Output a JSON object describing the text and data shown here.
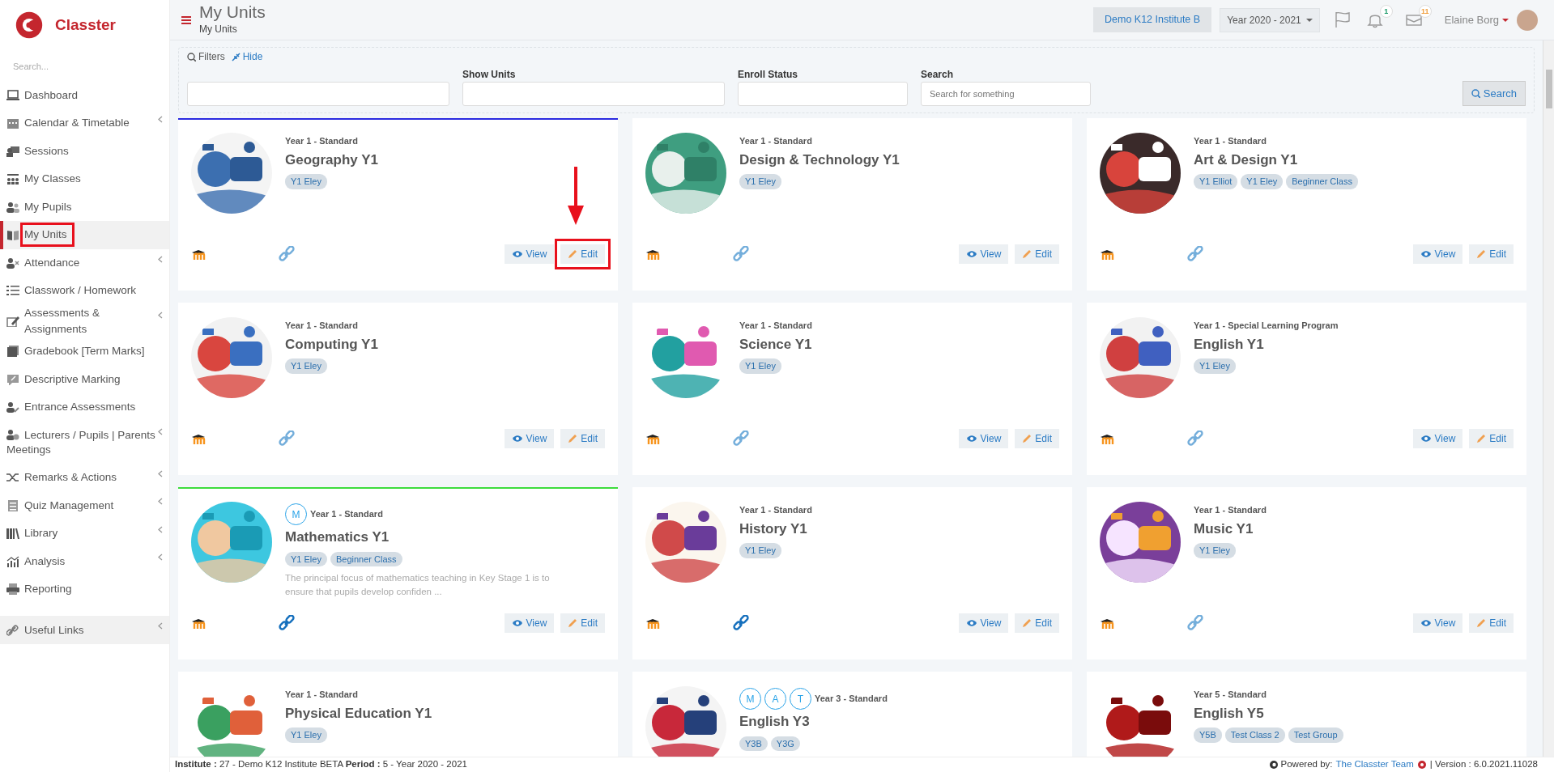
{
  "brand": {
    "name": "Classter"
  },
  "sidebar": {
    "search_placeholder": "Search...",
    "items": [
      {
        "label": "Dashboard",
        "selected": false,
        "has_submenu": false
      },
      {
        "label": "Calendar & Timetable",
        "selected": false,
        "has_submenu": true
      },
      {
        "label": "Sessions",
        "selected": false,
        "has_submenu": false
      },
      {
        "label": "My Classes",
        "selected": false,
        "has_submenu": false
      },
      {
        "label": "My Pupils",
        "selected": false,
        "has_submenu": false
      },
      {
        "label": "My Units",
        "selected": true,
        "has_submenu": false,
        "highlighted": true
      },
      {
        "label": "Attendance",
        "selected": false,
        "has_submenu": true
      },
      {
        "label": "Classwork / Homework",
        "selected": false,
        "has_submenu": false
      },
      {
        "label": "Assessments & Assignments",
        "selected": false,
        "has_submenu": true
      },
      {
        "label": "Gradebook [Term Marks]",
        "selected": false,
        "has_submenu": false
      },
      {
        "label": "Descriptive Marking",
        "selected": false,
        "has_submenu": false
      },
      {
        "label": "Entrance Assessments",
        "selected": false,
        "has_submenu": false
      },
      {
        "label": "Lecturers / Pupils | Parents Meetings",
        "selected": false,
        "has_submenu": true
      },
      {
        "label": "Remarks & Actions",
        "selected": false,
        "has_submenu": true
      },
      {
        "label": "Quiz Management",
        "selected": false,
        "has_submenu": true
      },
      {
        "label": "Library",
        "selected": false,
        "has_submenu": true
      },
      {
        "label": "Analysis",
        "selected": false,
        "has_submenu": true
      },
      {
        "label": "Reporting",
        "selected": false,
        "has_submenu": false
      }
    ],
    "footer_item": {
      "label": "Useful Links",
      "has_submenu": true
    }
  },
  "header": {
    "title": "My Units",
    "breadcrumb": "My Units",
    "institute": "Demo K12 Institute B",
    "year": "Year 2020 - 2021",
    "notifications": "1",
    "messages": "11",
    "user": "Elaine Borg"
  },
  "filters": {
    "title": "Filters",
    "hide": "Hide",
    "fields": [
      {
        "kind": "input"
      },
      {
        "kind": "input",
        "label": "Show Units"
      },
      {
        "kind": "input",
        "label": "Enroll Status"
      },
      {
        "kind": "input",
        "label": "Search",
        "placeholder": "Search for something"
      }
    ],
    "search_button": "Search"
  },
  "units": [
    {
      "level": "Year 1 - Standard",
      "title": "Geography Y1",
      "tags": [
        "Y1 Eley"
      ],
      "color": "#2a2ae0",
      "actions": {
        "view": "View",
        "edit": "Edit",
        "link_active": false,
        "highlighted": true
      }
    },
    {
      "level": "Year 1 - Standard",
      "title": "Design & Technology Y1",
      "tags": [
        "Y1 Eley"
      ],
      "actions": {
        "view": "View",
        "edit": "Edit",
        "link_active": false,
        "highlighted": false
      }
    },
    {
      "level": "Year 1 - Standard",
      "title": "Art & Design Y1",
      "tags": [
        "Y1 Elliot",
        "Y1 Eley",
        "Beginner Class"
      ],
      "actions": {
        "view": "View",
        "edit": "Edit",
        "link_active": false,
        "highlighted": false
      }
    },
    {
      "level": "Year 1 - Standard",
      "title": "Computing Y1",
      "tags": [
        "Y1 Eley"
      ],
      "actions": {
        "view": "View",
        "edit": "Edit",
        "link_active": false,
        "highlighted": false
      }
    },
    {
      "level": "Year 1 - Standard",
      "title": "Science Y1",
      "tags": [
        "Y1 Eley"
      ],
      "actions": {
        "view": "View",
        "edit": "Edit",
        "link_active": false,
        "highlighted": false
      }
    },
    {
      "level": "Year 1 - Special Learning Program",
      "title": "English Y1",
      "tags": [
        "Y1 Eley"
      ],
      "actions": {
        "view": "View",
        "edit": "Edit",
        "link_active": false,
        "highlighted": false
      }
    },
    {
      "level": "Year 1 - Standard",
      "title": "Mathematics Y1",
      "avatars": [
        "M"
      ],
      "tags": [
        "Y1 Eley",
        "Beginner Class"
      ],
      "description": "The principal focus of mathematics teaching in Key Stage 1 is to ensure that pupils develop confiden ...",
      "color": "#3ddc3d",
      "actions": {
        "view": "View",
        "edit": "Edit",
        "link_active": true,
        "highlighted": false
      }
    },
    {
      "level": "Year 1 - Standard",
      "title": "History Y1",
      "tags": [
        "Y1 Eley"
      ],
      "actions": {
        "view": "View",
        "edit": "Edit",
        "link_active": true,
        "highlighted": false
      }
    },
    {
      "level": "Year 1 - Standard",
      "title": "Music Y1",
      "tags": [
        "Y1 Eley"
      ],
      "actions": {
        "view": "View",
        "edit": "Edit",
        "link_active": false,
        "highlighted": false
      }
    },
    {
      "level": "Year 1 - Standard",
      "title": "Physical Education Y1",
      "tags": [
        "Y1 Eley"
      ]
    },
    {
      "level": "Year 3 - Standard",
      "title": "English Y3",
      "avatars": [
        "M",
        "A",
        "T"
      ],
      "tags": [
        "Y3B",
        "Y3G"
      ]
    },
    {
      "level": "Year 5 - Standard",
      "title": "English Y5",
      "tags": [
        "Y5B",
        "Test Class 2",
        "Test Group"
      ]
    }
  ],
  "footer": {
    "info": "**Institute :** 27 - Demo K12 Institute BETA **Period :** 5 - Year 2020 - 2021",
    "powered": "Powered by:",
    "team": "The Classter Team",
    "version": "| Version : 6.0.2021.11028"
  }
}
